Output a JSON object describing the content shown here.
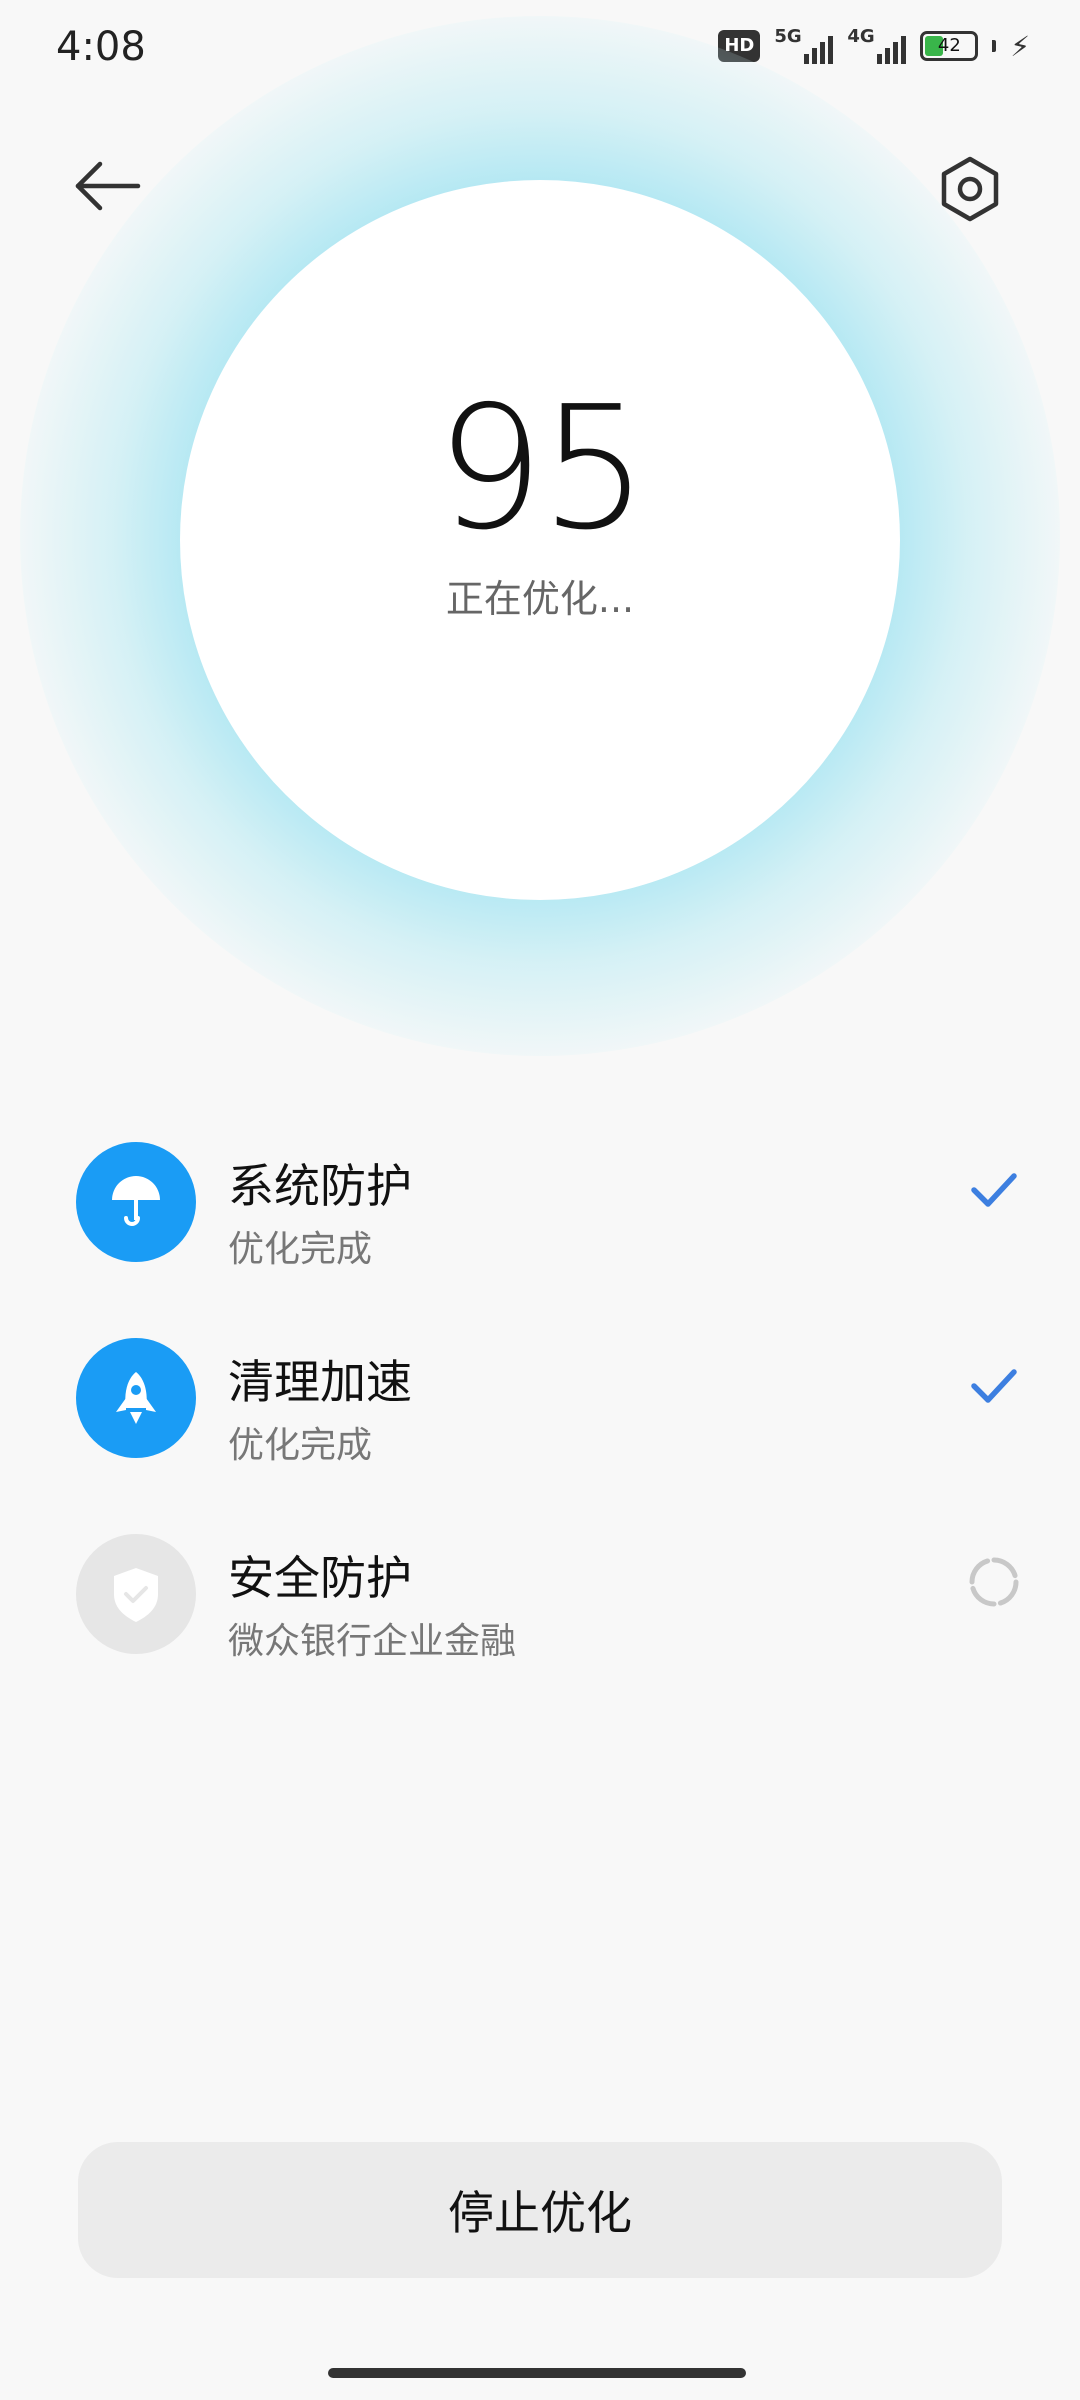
{
  "status_bar": {
    "time": "4:08",
    "hd_label": "HD",
    "net1_label": "5G",
    "net2_label": "4G",
    "battery_level": "42",
    "battery_fill_percent": 42
  },
  "header": {
    "back_icon": "arrow-left-icon",
    "settings_icon": "hexagon-gear-icon"
  },
  "score": {
    "value": "95",
    "status": "正在优化..."
  },
  "tasks": [
    {
      "title": "系统防护",
      "subtitle": "优化完成",
      "icon": "umbrella-icon",
      "state": "done",
      "color": "#1a9cf5"
    },
    {
      "title": "清理加速",
      "subtitle": "优化完成",
      "icon": "rocket-icon",
      "state": "done",
      "color": "#1a9cf5"
    },
    {
      "title": "安全防护",
      "subtitle": "微众银行企业金融",
      "icon": "shield-check-icon",
      "state": "loading",
      "color": "#e6e6e6"
    }
  ],
  "footer": {
    "stop_label": "停止优化"
  },
  "colors": {
    "accent": "#1a9cf5",
    "check": "#3d7fe0",
    "background": "#f8f8f8"
  }
}
